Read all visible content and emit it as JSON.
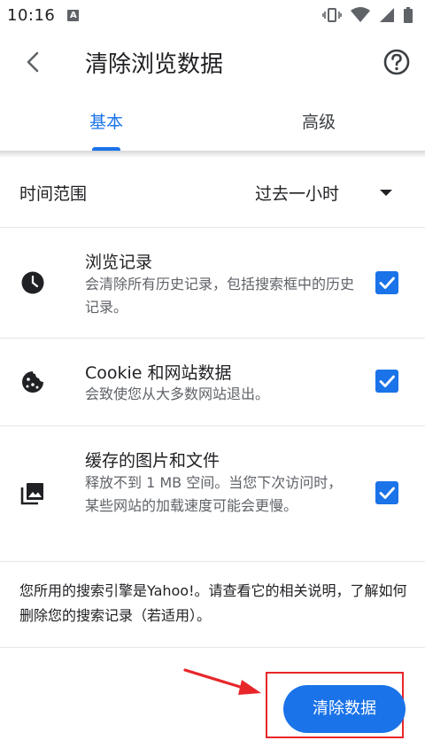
{
  "status_bar": {
    "time": "10:16",
    "badge": "A"
  },
  "app_bar": {
    "title": "清除浏览数据"
  },
  "tabs": [
    {
      "label": "基本"
    },
    {
      "label": "高级"
    }
  ],
  "time_range": {
    "label": "时间范围",
    "value": "过去一小时"
  },
  "items": [
    {
      "title": "浏览记录",
      "desc": "会清除所有历史记录，包括搜索框中的历史记录。",
      "checked": true,
      "icon": "clock-icon"
    },
    {
      "title": "Cookie 和网站数据",
      "desc": "会致使您从大多数网站退出。",
      "checked": true,
      "icon": "cookie-icon"
    },
    {
      "title": "缓存的图片和文件",
      "desc": "释放不到 1 MB 空间。当您下次访问时，某些网站的加载速度可能会更慢。",
      "checked": true,
      "icon": "images-icon"
    }
  ],
  "note": "您所用的搜索引擎是Yahoo!。请查看它的相关说明，了解如何删除您的搜索记录（若适用）。",
  "clear_button": {
    "label": "清除数据"
  },
  "colors": {
    "accent": "#1a73e8",
    "annotation": "#e8262a"
  }
}
